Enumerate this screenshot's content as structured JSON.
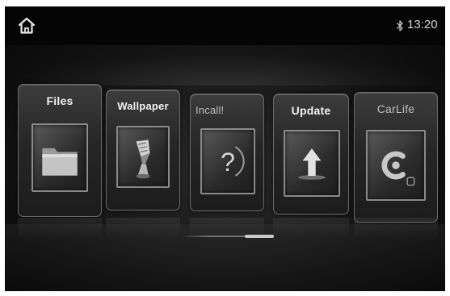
{
  "status_bar": {
    "time": "13:20",
    "home_icon": "home-icon",
    "bluetooth_icon": "bluetooth-icon"
  },
  "apps": [
    {
      "label": "Files",
      "icon": "folder-icon"
    },
    {
      "label": "Wallpaper",
      "icon": "paint-brush-icon"
    },
    {
      "label": "Incall!",
      "icon": "question-mark-icon"
    },
    {
      "label": "Update",
      "icon": "up-arrow-icon"
    },
    {
      "label": "CarLife",
      "icon": "carlife-icon"
    }
  ],
  "carousel": {
    "position": "2 of 5"
  }
}
